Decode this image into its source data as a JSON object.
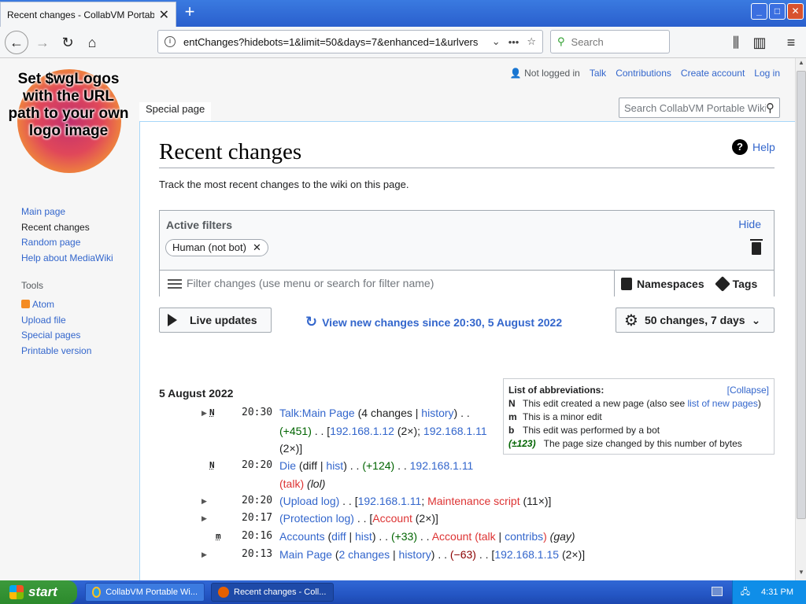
{
  "browser": {
    "tab_title": "Recent changes - CollabVM Portable Wiki",
    "new_tab": "+",
    "url": "entChanges?hidebots=1&limit=50&days=7&enhanced=1&urlvers",
    "url_dots": "•••",
    "search_placeholder": "Search",
    "window_min": "_",
    "window_max": "□",
    "window_close": "✕"
  },
  "wiki": {
    "logo_text": "Set $wgLogos with the URL path to your own logo image",
    "user_links": {
      "not_logged_in": "Not logged in",
      "talk": "Talk",
      "contributions": "Contributions",
      "create_account": "Create account",
      "log_in": "Log in"
    },
    "tab_special": "Special page",
    "search_placeholder": "Search CollabVM Portable Wiki",
    "nav": {
      "main_page": "Main page",
      "recent_changes": "Recent changes",
      "random_page": "Random page",
      "help": "Help about MediaWiki"
    },
    "tools": {
      "heading": "Tools",
      "atom": "Atom",
      "upload": "Upload file",
      "special": "Special pages",
      "printable": "Printable version"
    },
    "page_title": "Recent changes",
    "help_label": "Help",
    "tagline": "Track the most recent changes to the wiki on this page.",
    "filters": {
      "heading": "Active filters",
      "hide": "Hide",
      "chip": "Human (not bot)",
      "placeholder": "Filter changes (use menu or search for filter name)",
      "namespaces": "Namespaces",
      "tags": "Tags"
    },
    "live_updates": "Live updates",
    "view_new": "View new changes since 20:30, 5 August 2022",
    "changes_option": "50 changes, 7 days",
    "legend": {
      "title": "List of abbreviations:",
      "collapse": "[Collapse]",
      "n_key": "N",
      "n_text": "This edit created a new page (also see ",
      "n_link": "list of new pages",
      "n_end": ")",
      "m_key": "m",
      "m_text": "This is a minor edit",
      "b_key": "b",
      "b_text": "This edit was performed by a bot",
      "size_key": "(±123)",
      "size_text": "The page size changed by this number of bytes"
    },
    "date_heading": "5 August 2022",
    "changes": [
      {
        "time": "20:30",
        "flag": "N",
        "arrow": "▶",
        "page": "Talk:Main Page",
        "mid": " (4 changes | ",
        "hist": "history",
        "tail": ") . .",
        "size": "(+451)",
        "dots": " . . [",
        "user1": "192.168.1.12",
        "u1c": " (2×); ",
        "user2": "192.168.1.11",
        "end": "(2×)]"
      },
      {
        "time": "20:20",
        "flag": "N",
        "page": "Die",
        "diff": " (diff | ",
        "hist": "hist",
        "mid": ") . . ",
        "size": "(+124)",
        "dots": " . . ",
        "user": "192.168.1.11",
        "talk": "talk",
        "comment": "(lol)"
      },
      {
        "time": "20:20",
        "arrow": "▶",
        "log": "(Upload log)",
        "dots": " . . [",
        "user": "192.168.1.11",
        "sep": "; ",
        "user2": "Maintenance script",
        "cnt": " (11×)]"
      },
      {
        "time": "20:17",
        "arrow": "▶",
        "log": "(Protection log)",
        "dots": " . . [",
        "user": "Account",
        "cnt": " (2×)]"
      },
      {
        "time": "20:16",
        "flag": "m",
        "page": "Accounts",
        "diff": "diff",
        "hist": "hist",
        "size": "(+33)",
        "user": "Account",
        "talk": "talk",
        "contribs": "contribs",
        "comment": "(gay)"
      },
      {
        "time": "20:13",
        "arrow": "▶",
        "page": "Main Page",
        "changes": "2 changes",
        "hist": "history",
        "size": "(−63)",
        "user": "192.168.1.15",
        "cnt": " (2×)]"
      }
    ]
  },
  "taskbar": {
    "start": "start",
    "item1": "CollabVM Portable Wi...",
    "item2": "Recent changes - Coll...",
    "clock": "4:31 PM"
  }
}
